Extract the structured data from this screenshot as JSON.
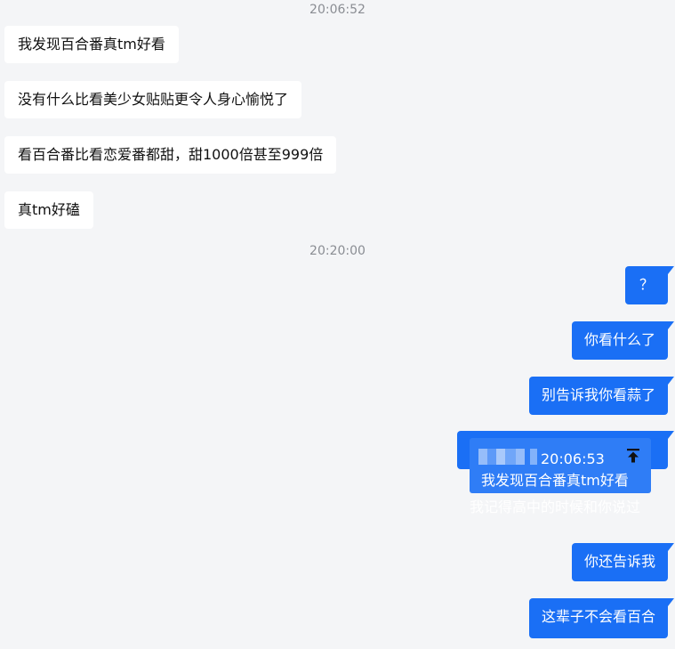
{
  "timestamps": {
    "first": "20:06:52",
    "second": "20:20:00"
  },
  "incoming": [
    {
      "text": "我发现百合番真tm好看"
    },
    {
      "text": "没有什么比看美少女贴贴更令人身心愉悦了"
    },
    {
      "text": "看百合番比看恋爱番都甜，甜1000倍甚至999倍"
    },
    {
      "text": "真tm好磕"
    }
  ],
  "outgoing": [
    {
      "text": "？"
    },
    {
      "text": "你看什么了"
    },
    {
      "text": "别告诉我你看蒜了"
    },
    {
      "text": "你还告诉我"
    },
    {
      "text": "这辈子不会看百合"
    }
  ],
  "quote": {
    "time": "20:06:53",
    "text": "我发现百合番真tm好看",
    "reply": "我记得高中的时候和你说过",
    "jump_icon": "jump-to-top-icon"
  },
  "colors": {
    "outgoing_bubble": "#1a6ff5",
    "incoming_bubble": "#ffffff",
    "background": "#f4f5f7"
  }
}
